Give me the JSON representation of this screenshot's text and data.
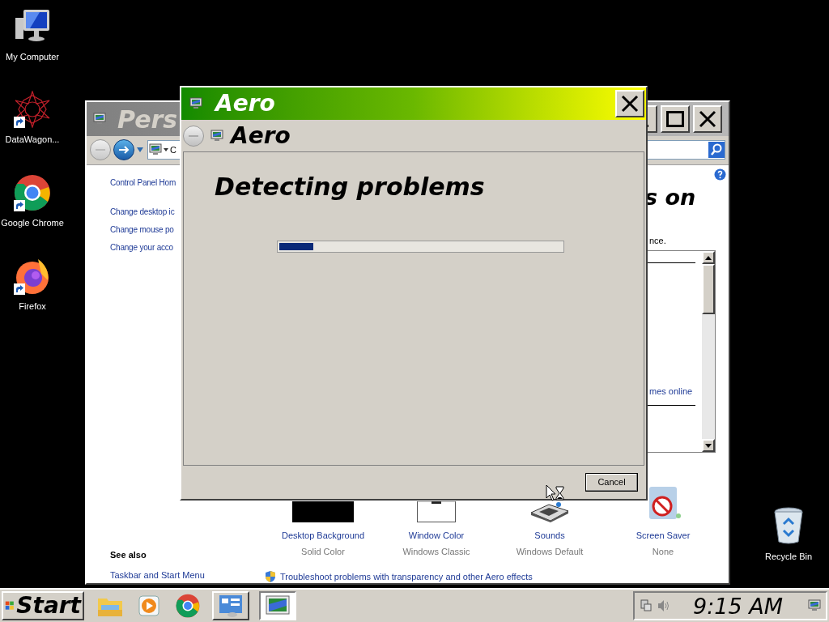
{
  "desktop_icons": [
    {
      "label": "My Computer",
      "kind": "computer",
      "shortcut": false
    },
    {
      "label": "DataWagon...",
      "kind": "starburst",
      "shortcut": true
    },
    {
      "label": "Google Chrome",
      "kind": "chrome",
      "shortcut": true
    },
    {
      "label": "Firefox",
      "kind": "firefox",
      "shortcut": true
    },
    {
      "label": "Recycle Bin",
      "kind": "recycle",
      "shortcut": false
    }
  ],
  "background_window": {
    "title": "Pers",
    "address": "C",
    "left_links": [
      "Control Panel Hom",
      "Change desktop ic",
      "Change mouse po",
      "Change your acco"
    ],
    "heading": "s on",
    "note": "nce.",
    "list_link": "mes online",
    "items": [
      {
        "label": "Desktop Background",
        "value": "Solid Color",
        "kind": "background"
      },
      {
        "label": "Window Color",
        "value": "Windows Classic",
        "kind": "window"
      },
      {
        "label": "Sounds",
        "value": "Windows Default",
        "kind": "sounds"
      },
      {
        "label": "Screen Saver",
        "value": "None",
        "kind": "screensaver"
      }
    ],
    "see_also_title": "See also",
    "see_also_links": [
      "Taskbar and Start Menu"
    ],
    "troubleshoot_link": "Troubleshoot problems with transparency and other Aero effects"
  },
  "dialog": {
    "title": "Aero",
    "nav_title": "Aero",
    "heading": "Detecting problems",
    "progress": {
      "level": 0.12
    },
    "cancel": "Cancel"
  },
  "taskbar": {
    "start": "Start",
    "buttons": [
      {
        "kind": "explorer",
        "task": false,
        "selected": false
      },
      {
        "kind": "media",
        "task": false,
        "selected": false
      },
      {
        "kind": "chrome",
        "task": false,
        "selected": false
      },
      {
        "kind": "control",
        "task": true,
        "selected": false
      },
      {
        "kind": "personalize",
        "task": true,
        "selected": true
      }
    ],
    "clock": "9:15 AM"
  }
}
